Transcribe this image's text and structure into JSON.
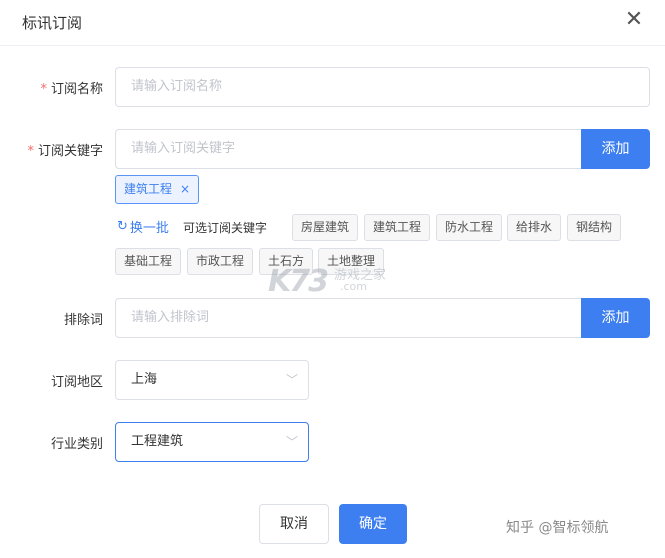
{
  "dialog": {
    "title": "标讯订阅",
    "close_glyph": "✕"
  },
  "form": {
    "name": {
      "label": "订阅名称",
      "required_mark": "*",
      "placeholder": "请输入订阅名称"
    },
    "keyword": {
      "label": "订阅关键字",
      "required_mark": "*",
      "placeholder": "请输入订阅关键字",
      "add_label": "添加",
      "selected": [
        {
          "label": "建筑工程",
          "remove_glyph": "×"
        }
      ],
      "refresh_label": "换一批",
      "refresh_glyph": "↻",
      "optional_label": "可选订阅关键字",
      "suggestions": [
        "房屋建筑",
        "建筑工程",
        "防水工程",
        "给排水",
        "钢结构",
        "基础工程",
        "市政工程",
        "土石方",
        "土地整理"
      ]
    },
    "exclude": {
      "label": "排除词",
      "placeholder": "请输入排除词",
      "add_label": "添加"
    },
    "region": {
      "label": "订阅地区",
      "value": "上海"
    },
    "industry": {
      "label": "行业类别",
      "value": "工程建筑"
    }
  },
  "footer": {
    "cancel_label": "取消",
    "confirm_label": "确定"
  },
  "watermark": {
    "logo": "K73",
    "sub": "游戏之家",
    "domain": ".com"
  },
  "credit": "知乎 @智标领航",
  "colors": {
    "accent": "#3d7ff0",
    "required": "#f56c6c"
  }
}
